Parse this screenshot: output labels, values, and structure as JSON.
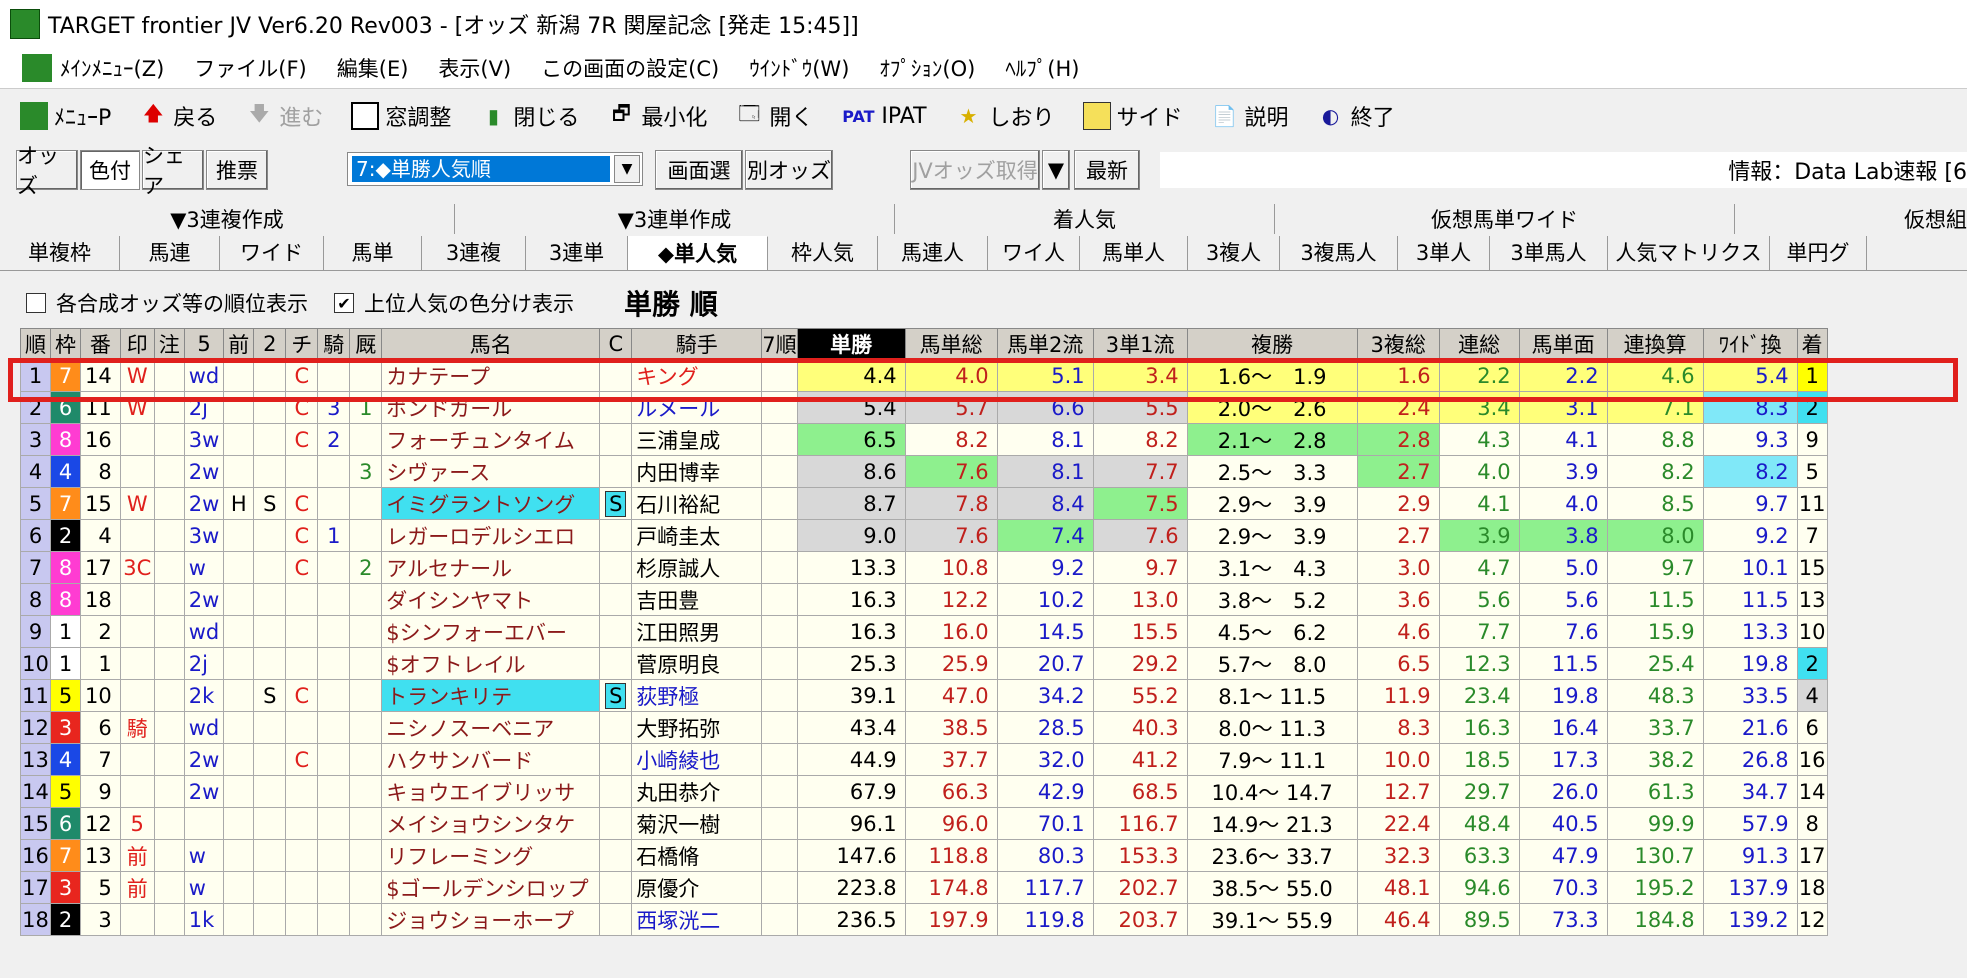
{
  "window": {
    "title": "TARGET frontier JV  Ver6.20  Rev003 - [オッズ 新潟 7R 関屋記念  [発走 15:45]]"
  },
  "menu": [
    "ﾒｲﾝﾒﾆｭｰ(Z)",
    "ファイル(F)",
    "編集(E)",
    "表示(V)",
    "この画面の設定(C)",
    "ｳｲﾝﾄﾞｳ(W)",
    "ｵﾌﾟｼｮﾝ(O)",
    "ﾍﾙﾌﾟ(H)"
  ],
  "toolbar": {
    "menu_p": "ﾒﾆｭｰP",
    "back": "戻る",
    "forward": "進む",
    "window_adjust": "窓調整",
    "close": "閉じる",
    "minimize": "最小化",
    "open": "開く",
    "ipat_logo": "PAT",
    "ipat": "IPAT",
    "bookmark": "しおり",
    "side": "サイド",
    "help": "説明",
    "exit": "終了"
  },
  "controls": {
    "odds": "オッズ",
    "color": "色付",
    "share": "シェア",
    "recommend": "推票",
    "sort_select": "7:◆単勝人気順",
    "screen_select": "画面選",
    "other_odds": "別オッズ",
    "jv_fetch": "JVオッズ取得",
    "refresh": "最新",
    "info": "情報：Data Lab速報 [6"
  },
  "tabs_top": [
    "▼3連複作成",
    "▼3連単作成",
    "着人気",
    "仮想馬単ワイド",
    "仮想組"
  ],
  "tabs_bottom": [
    "単複枠",
    "馬連",
    "ワイド",
    "馬単",
    "3連複",
    "3連単",
    "◆単人気",
    "枠人気",
    "馬連人",
    "ワイ人",
    "馬単人",
    "3複人",
    "3複馬人",
    "3単人",
    "3単馬人",
    "人気マトリクス",
    "単円グ"
  ],
  "options": {
    "opt1": "各合成オッズ等の順位表示",
    "opt2": "上位人気の色分け表示",
    "view_title": "単勝 順"
  },
  "table": {
    "headers": [
      "順",
      "枠",
      "番",
      "印",
      "注",
      "5",
      "前",
      "2",
      "チ",
      "騎",
      "厩",
      "馬名",
      "C",
      "騎手",
      "7順",
      "単勝",
      "馬単総",
      "馬単2流",
      "3単1流",
      "複勝",
      "3複総",
      "連総",
      "馬単面",
      "連換算",
      "ﾜｲﾄﾞ換",
      "着"
    ],
    "rows": [
      [
        "1",
        "7",
        "14",
        "W",
        "",
        "wd",
        "",
        "",
        "C",
        "",
        "",
        "カナテープ",
        "",
        "キング",
        "",
        "4.4",
        "4.0",
        "5.1",
        "3.4",
        "1.6～　1.9",
        "1.6",
        "2.2",
        "2.2",
        "4.6",
        "5.4",
        "1"
      ],
      [
        "2",
        "6",
        "11",
        "W",
        "",
        "2j",
        "",
        "",
        "C",
        "3",
        "1",
        "ボンドガール",
        "",
        "ルメール",
        "",
        "5.4",
        "5.7",
        "6.6",
        "5.5",
        "2.0～　2.6",
        "2.4",
        "3.4",
        "3.1",
        "7.1",
        "8.3",
        "2"
      ],
      [
        "3",
        "8",
        "16",
        "",
        "",
        "3w",
        "",
        "",
        "C",
        "2",
        "",
        "フォーチュンタイム",
        "",
        "三浦皇成",
        "",
        "6.5",
        "8.2",
        "8.1",
        "8.2",
        "2.1～　2.8",
        "2.8",
        "4.3",
        "4.1",
        "8.8",
        "9.3",
        "9"
      ],
      [
        "4",
        "4",
        "8",
        "",
        "",
        "2w",
        "",
        "",
        "",
        "",
        "3",
        "シヴァース",
        "",
        "内田博幸",
        "",
        "8.6",
        "7.6",
        "8.1",
        "7.7",
        "2.5～　3.3",
        "2.7",
        "4.0",
        "3.9",
        "8.2",
        "8.2",
        "5"
      ],
      [
        "5",
        "7",
        "15",
        "W",
        "",
        "2w",
        "H",
        "S",
        "C",
        "",
        "",
        "イミグラントソング",
        "S",
        "石川裕紀",
        "",
        "8.7",
        "7.8",
        "8.4",
        "7.5",
        "2.9～　3.9",
        "2.9",
        "4.1",
        "4.0",
        "8.5",
        "9.7",
        "11"
      ],
      [
        "6",
        "2",
        "4",
        "",
        "",
        "3w",
        "",
        "",
        "C",
        "1",
        "",
        "レガーロデルシエロ",
        "",
        "戸崎圭太",
        "",
        "9.0",
        "7.6",
        "7.4",
        "7.6",
        "2.9～　3.9",
        "2.7",
        "3.9",
        "3.8",
        "8.0",
        "9.2",
        "7"
      ],
      [
        "7",
        "8",
        "17",
        "3C",
        "",
        "w",
        "",
        "",
        "C",
        "",
        "2",
        "アルセナール",
        "",
        "杉原誠人",
        "",
        "13.3",
        "10.8",
        "9.2",
        "9.7",
        "3.1～　4.3",
        "3.0",
        "4.7",
        "5.0",
        "9.7",
        "10.1",
        "15"
      ],
      [
        "8",
        "8",
        "18",
        "",
        "",
        "2w",
        "",
        "",
        "",
        "",
        "",
        "ダイシンヤマト",
        "",
        "吉田豊",
        "",
        "16.3",
        "12.2",
        "10.2",
        "13.0",
        "3.8～　5.2",
        "3.6",
        "5.6",
        "5.6",
        "11.5",
        "11.5",
        "13"
      ],
      [
        "9",
        "1",
        "2",
        "",
        "",
        "wd",
        "",
        "",
        "",
        "",
        "",
        "$シンフォーエバー",
        "",
        "江田照男",
        "",
        "16.3",
        "16.0",
        "14.5",
        "15.5",
        "4.5～　6.2",
        "4.6",
        "7.7",
        "7.6",
        "15.9",
        "13.3",
        "10"
      ],
      [
        "10",
        "1",
        "1",
        "",
        "",
        "2j",
        "",
        "",
        "",
        "",
        "",
        "$オフトレイル",
        "",
        "菅原明良",
        "",
        "25.3",
        "25.9",
        "20.7",
        "29.2",
        "5.7～　8.0",
        "6.5",
        "12.3",
        "11.5",
        "25.4",
        "19.8",
        "2"
      ],
      [
        "11",
        "5",
        "10",
        "",
        "",
        "2k",
        "",
        "S",
        "C",
        "",
        "",
        "トランキリテ",
        "S",
        "荻野極",
        "",
        "39.1",
        "47.0",
        "34.2",
        "55.2",
        "8.1～ 11.5",
        "11.9",
        "23.4",
        "19.8",
        "48.3",
        "33.5",
        "4"
      ],
      [
        "12",
        "3",
        "6",
        "騎",
        "",
        "wd",
        "",
        "",
        "",
        "",
        "",
        "ニシノスーベニア",
        "",
        "大野拓弥",
        "",
        "43.4",
        "38.5",
        "28.5",
        "40.3",
        "8.0～ 11.3",
        "8.3",
        "16.3",
        "16.4",
        "33.7",
        "21.6",
        "6"
      ],
      [
        "13",
        "4",
        "7",
        "",
        "",
        "2w",
        "",
        "",
        "C",
        "",
        "",
        "ハクサンバード",
        "",
        "小崎綾也",
        "",
        "44.9",
        "37.7",
        "32.0",
        "41.2",
        "7.9～ 11.1",
        "10.0",
        "18.5",
        "17.3",
        "38.2",
        "26.8",
        "16"
      ],
      [
        "14",
        "5",
        "9",
        "",
        "",
        "2w",
        "",
        "",
        "",
        "",
        "",
        "キョウエイブリッサ",
        "",
        "丸田恭介",
        "",
        "67.9",
        "66.3",
        "42.9",
        "68.5",
        "10.4～ 14.7",
        "12.7",
        "29.7",
        "26.0",
        "61.3",
        "34.7",
        "14"
      ],
      [
        "15",
        "6",
        "12",
        "5",
        "",
        "",
        "",
        "",
        "",
        "",
        "",
        "メイショウシンタケ",
        "",
        "菊沢一樹",
        "",
        "96.1",
        "96.0",
        "70.1",
        "116.7",
        "14.9～ 21.3",
        "22.4",
        "48.4",
        "40.5",
        "99.9",
        "57.9",
        "8"
      ],
      [
        "16",
        "7",
        "13",
        "前",
        "",
        "w",
        "",
        "",
        "",
        "",
        "",
        "リフレーミング",
        "",
        "石橋脩",
        "",
        "147.6",
        "118.8",
        "80.3",
        "153.3",
        "23.6～ 33.7",
        "32.3",
        "63.3",
        "47.9",
        "130.7",
        "91.3",
        "17"
      ],
      [
        "17",
        "3",
        "5",
        "前",
        "",
        "w",
        "",
        "",
        "",
        "",
        "",
        "$ゴールデンシロップ",
        "",
        "原優介",
        "",
        "223.8",
        "174.8",
        "117.7",
        "202.7",
        "38.5～ 55.0",
        "48.1",
        "94.6",
        "70.3",
        "195.2",
        "137.9",
        "18"
      ],
      [
        "18",
        "2",
        "3",
        "",
        "",
        "1k",
        "",
        "",
        "",
        "",
        "",
        "ジョウショーホープ",
        "",
        "西塚洸二",
        "",
        "236.5",
        "197.9",
        "119.8",
        "203.7",
        "39.1～ 55.9",
        "46.4",
        "89.5",
        "73.3",
        "184.8",
        "139.2",
        "12"
      ]
    ]
  }
}
